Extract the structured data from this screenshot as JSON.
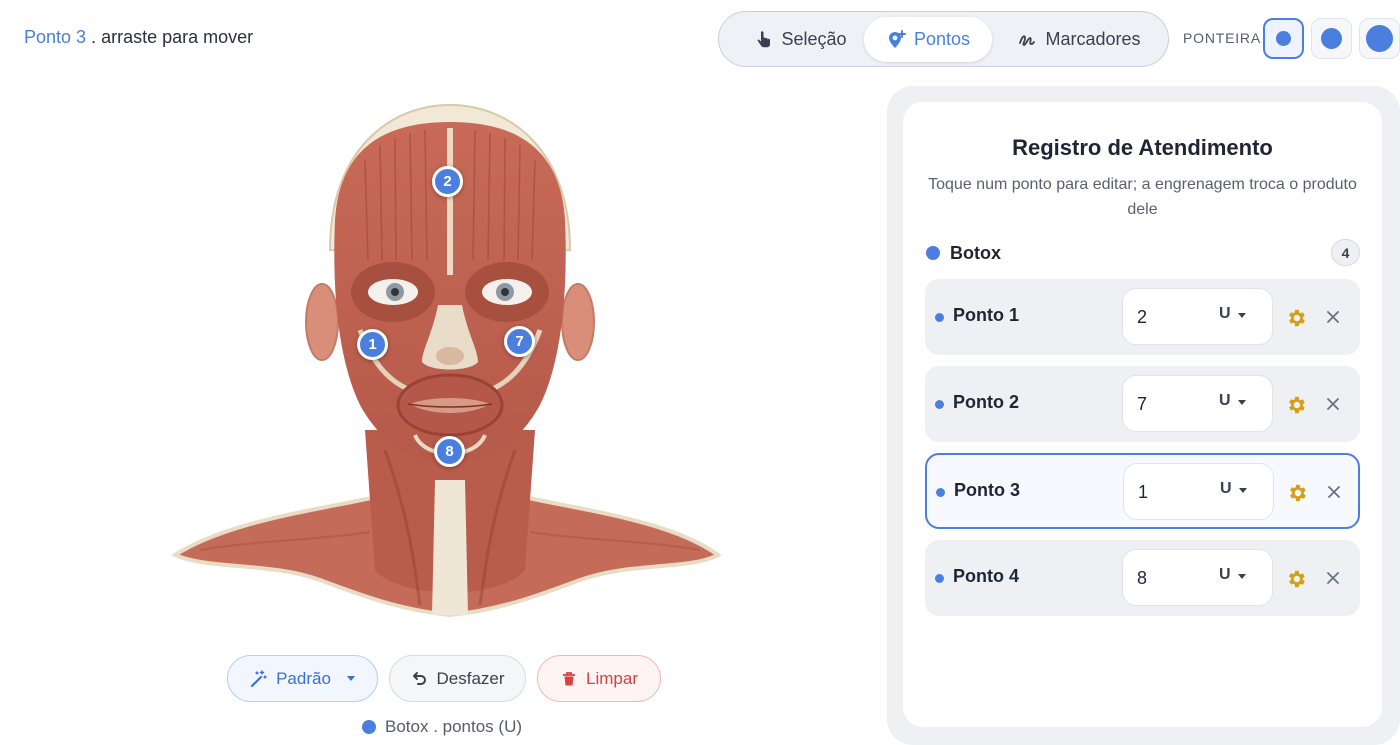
{
  "status": {
    "highlight": "Ponto 3",
    "text": ". arraste para mover"
  },
  "modes": [
    {
      "label": "Seleção",
      "icon": "hand-pointer-icon",
      "active": false
    },
    {
      "label": "Pontos",
      "icon": "map-pin-plus-icon",
      "active": true
    },
    {
      "label": "Marcadores",
      "icon": "squiggle-icon",
      "active": false
    }
  ],
  "ponteira": {
    "label": "PONTEIRA",
    "sizes": [
      "small",
      "medium",
      "large"
    ],
    "selected": "small"
  },
  "head_markers": [
    "2",
    "1",
    "7",
    "8"
  ],
  "actions": {
    "padrao": "Padrão",
    "desfazer": "Desfazer",
    "limpar": "Limpar"
  },
  "legend": "Botox . pontos (U)",
  "panel": {
    "title": "Registro de Atendimento",
    "subtitle": "Toque num ponto para editar; a engrenagem troca o produto dele",
    "group": {
      "name": "Botox",
      "count": "4",
      "color": "#4a7fe0"
    },
    "points": [
      {
        "name": "Ponto 1",
        "value": "2",
        "unit": "U",
        "active": false
      },
      {
        "name": "Ponto 2",
        "value": "7",
        "unit": "U",
        "active": false
      },
      {
        "name": "Ponto 3",
        "value": "1",
        "unit": "U",
        "active": true
      },
      {
        "name": "Ponto 4",
        "value": "8",
        "unit": "U",
        "active": false
      }
    ]
  },
  "colors": {
    "accent": "#4a7fe0",
    "danger": "#d84040",
    "gear": "#d4a017"
  }
}
